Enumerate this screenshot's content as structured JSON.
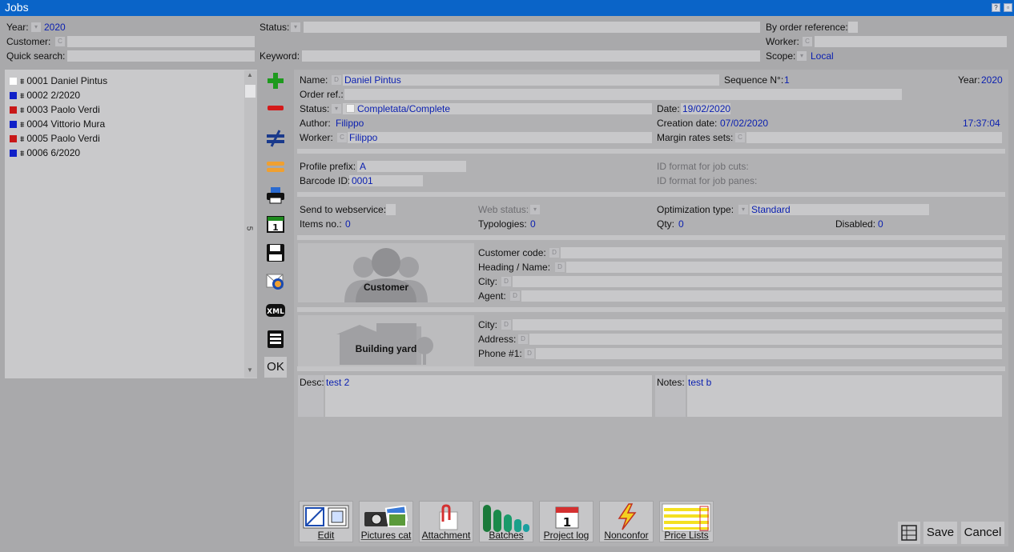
{
  "window": {
    "title": "Jobs"
  },
  "filters": {
    "year_label": "Year:",
    "year_value": "2020",
    "status_label": "Status:",
    "by_order_ref_label": "By order reference:",
    "customer_label": "Customer:",
    "worker_label": "Worker:",
    "quick_search_label": "Quick search:",
    "keyword_label": "Keyword:",
    "scope_label": "Scope:",
    "scope_value": "Local"
  },
  "job_list": {
    "items": [
      {
        "text": "0001 Daniel Pintus",
        "color": "#ffffff"
      },
      {
        "text": "0002 2/2020",
        "color": "#1020c8"
      },
      {
        "text": "0003 Paolo Verdi",
        "color": "#c81818"
      },
      {
        "text": "0004 Vittorio Mura",
        "color": "#1020c8"
      },
      {
        "text": "0005 Paolo Verdi",
        "color": "#c81818"
      },
      {
        "text": "0006 6/2020",
        "color": "#1020c8"
      }
    ],
    "count": "5"
  },
  "toolbar": {
    "ok_label": "OK"
  },
  "details": {
    "name_label": "Name:",
    "name_value": "Daniel Pintus",
    "sequence_label": "Sequence N°:",
    "sequence_value": "1",
    "year_label": "Year:",
    "year_value": "2020",
    "order_ref_label": "Order ref.:",
    "status_label": "Status:",
    "status_value": "Completata/Complete",
    "date_label": "Date:",
    "date_value": "19/02/2020",
    "author_label": "Author:",
    "author_value": "Filippo",
    "creation_date_label": "Creation date:",
    "creation_date_value": "07/02/2020",
    "creation_time": "17:37:04",
    "worker_label": "Worker:",
    "worker_value": "Filippo",
    "margin_rates_label": "Margin rates sets:",
    "profile_prefix_label": "Profile prefix:",
    "profile_prefix_value": "A",
    "id_format_cuts_label": "ID format for job cuts:",
    "barcode_label": "Barcode ID:",
    "barcode_value": "0001",
    "id_format_panes_label": "ID format for job panes:",
    "send_ws_label": "Send to webservice:",
    "web_status_label": "Web status:",
    "opt_type_label": "Optimization type:",
    "opt_type_value": "Standard",
    "items_no_label": "Items no.:",
    "items_no_value": "0",
    "typologies_label": "Typologies:",
    "typologies_value": "0",
    "qty_label": "Qty:",
    "qty_value": "0",
    "disabled_label": "Disabled:",
    "disabled_value": "0"
  },
  "customer": {
    "caption": "Customer",
    "code_label": "Customer code:",
    "heading_label": "Heading / Name:",
    "city_label": "City:",
    "agent_label": "Agent:"
  },
  "building_yard": {
    "caption": "Building yard",
    "city_label": "City:",
    "address_label": "Address:",
    "phone_label": "Phone #1:"
  },
  "desc": {
    "label": "Desc:",
    "value": "test 2"
  },
  "notes": {
    "label": "Notes:",
    "value": "test b"
  },
  "bottom_buttons": {
    "edit": "Edit",
    "pictures": "Pictures cat",
    "attachment": "Attachment",
    "batches": "Batches",
    "project_log": "Project log",
    "nonconfor": "Nonconfor",
    "price_lists": "Price Lists"
  },
  "actions": {
    "save": "Save",
    "cancel": "Cancel"
  },
  "mini_letters": {
    "c": "C",
    "d": "D"
  },
  "colors": {
    "titlebar": "#0a64c8",
    "value_text": "#0a1fb0",
    "background": "#a9a9ab"
  }
}
